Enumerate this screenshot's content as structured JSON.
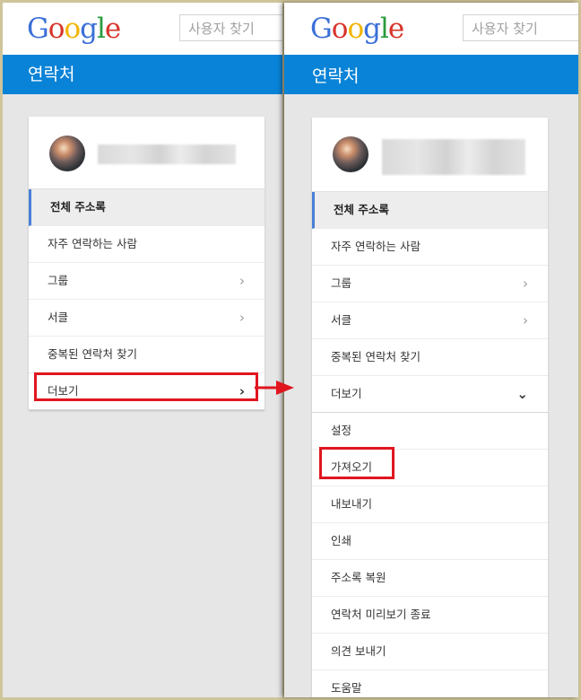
{
  "left": {
    "logo": "Google",
    "search_placeholder": "사용자 찾기",
    "section_title": "연락처",
    "nav": [
      {
        "label": "전체 주소록",
        "active": true
      },
      {
        "label": "자주 연락하는 사람"
      },
      {
        "label": "그룹",
        "chevron": "›"
      },
      {
        "label": "서클",
        "chevron": "›"
      },
      {
        "label": "중복된 연락처 찾기"
      },
      {
        "label": "더보기",
        "chevron": "›"
      }
    ]
  },
  "right": {
    "logo": "Google",
    "search_placeholder": "사용자 찾기",
    "section_title": "연락처",
    "nav": [
      {
        "label": "전체 주소록",
        "active": true
      },
      {
        "label": "자주 연락하는 사람"
      },
      {
        "label": "그룹",
        "chevron": "›"
      },
      {
        "label": "서클",
        "chevron": "›"
      },
      {
        "label": "중복된 연락처 찾기"
      },
      {
        "label": "더보기",
        "chevron": "⌄"
      }
    ],
    "more_items": [
      "설정",
      "가져오기",
      "내보내기",
      "인쇄",
      "주소록 복원",
      "연락처 미리보기 종료",
      "의견 보내기",
      "도움말"
    ]
  },
  "colors": {
    "blue_bar": "#0983d7",
    "highlight_red": "#e0161f",
    "active_border": "#4a7fd8"
  }
}
